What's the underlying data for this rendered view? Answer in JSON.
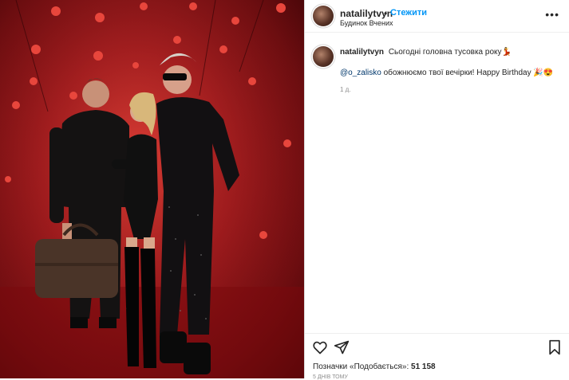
{
  "post": {
    "username": "natalilytvyn",
    "separator": "•",
    "follow_label": "Стежити",
    "location": "Будинок Вчених",
    "more_icon": "more-dots-icon",
    "caption_username": "natalilytvyn",
    "caption_text": "Сьогодні головна тусовка року💃",
    "reply_mention": "@o_zalisko",
    "reply_text": " обожнюємо твої вечірки! Happy Birthday 🎉😍",
    "time_ago": "1 д.",
    "likes_prefix": "Позначки «Подобається»: ",
    "likes_count": "51 158",
    "date_text": "5 днів тому"
  },
  "actions": {
    "like_icon": "heart-icon",
    "share_icon": "send-icon",
    "save_icon": "bookmark-icon"
  },
  "colors": {
    "follow_accent": "#0095f6",
    "mention": "#00376b",
    "photo_background": "#a4181c"
  }
}
